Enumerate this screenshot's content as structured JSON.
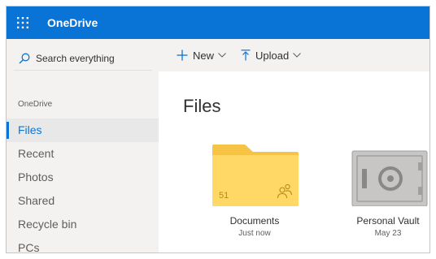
{
  "app": {
    "title": "OneDrive"
  },
  "search": {
    "label": "Search everything"
  },
  "sidebar": {
    "heading": "OneDrive",
    "items": [
      {
        "label": "Files",
        "active": true
      },
      {
        "label": "Recent"
      },
      {
        "label": "Photos"
      },
      {
        "label": "Shared"
      },
      {
        "label": "Recycle bin"
      },
      {
        "label": "PCs"
      }
    ]
  },
  "toolbar": {
    "new_label": "New",
    "upload_label": "Upload"
  },
  "main": {
    "title": "Files",
    "tiles": [
      {
        "name": "Documents",
        "date": "Just now",
        "count": "51",
        "icon": "folder-icon",
        "shared": true
      },
      {
        "name": "Personal Vault",
        "date": "May 23",
        "icon": "vault-icon"
      }
    ]
  },
  "colors": {
    "brand": "#0a73d6",
    "sidebar_bg": "#f3f2f1",
    "folder": "#ffd866",
    "folder_dark": "#f6c344",
    "vault": "#c8c6c4"
  }
}
